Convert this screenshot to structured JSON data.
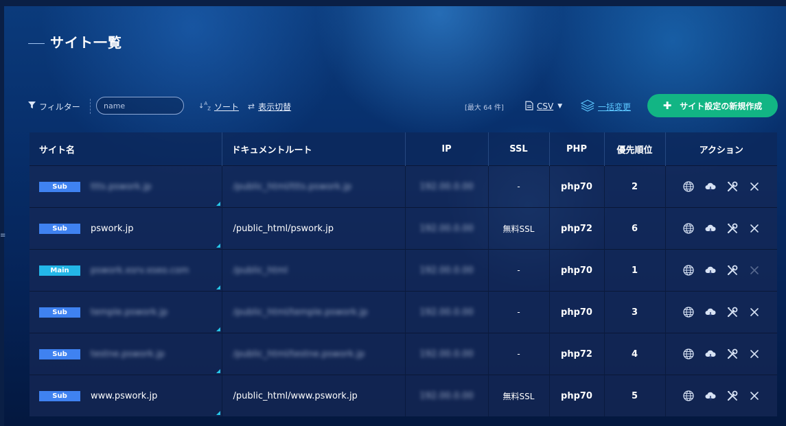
{
  "page": {
    "title": "サイト一覧"
  },
  "toolbar": {
    "filter_label": "フィルター",
    "search_placeholder": "name",
    "sort_label": "ソート",
    "display_toggle_label": "表示切替",
    "max_count": "[最大 64 件]",
    "csv_label": "CSV",
    "bulk_change_label": "一括変更",
    "create_label": "サイト設定の新規作成"
  },
  "table": {
    "headers": [
      "サイト名",
      "ドキュメントルート",
      "IP",
      "SSL",
      "PHP",
      "優先順位",
      "アクション"
    ],
    "rows": [
      {
        "type": "Sub",
        "name": "ttts.pswork.jp",
        "name_hidden": true,
        "root": "/public_html/ttts.pswork.jp",
        "root_hidden": true,
        "ip": "192.00.0.00",
        "ip_hidden": true,
        "ssl": "-",
        "php": "php70",
        "priority": "2",
        "delete_enabled": true
      },
      {
        "type": "Sub",
        "name": "pswork.jp",
        "name_hidden": false,
        "root": "/public_html/pswork.jp",
        "root_hidden": false,
        "ip": "192.00.0.00",
        "ip_hidden": true,
        "ssl": "無料SSL",
        "php": "php72",
        "priority": "6",
        "delete_enabled": true
      },
      {
        "type": "Main",
        "name": "pswork.xsrv.xseo.com",
        "name_hidden": true,
        "root": "/public_html",
        "root_hidden": true,
        "ip": "192.00.0.00",
        "ip_hidden": true,
        "ssl": "-",
        "php": "php70",
        "priority": "1",
        "delete_enabled": false
      },
      {
        "type": "Sub",
        "name": "temple.pswork.jp",
        "name_hidden": true,
        "root": "/public_html/temple.pswork.jp",
        "root_hidden": true,
        "ip": "192.00.0.00",
        "ip_hidden": true,
        "ssl": "-",
        "php": "php70",
        "priority": "3",
        "delete_enabled": true
      },
      {
        "type": "Sub",
        "name": "testne.pswork.jp",
        "name_hidden": true,
        "root": "/public_html/testne.pswork.jp",
        "root_hidden": true,
        "ip": "192.00.0.00",
        "ip_hidden": true,
        "ssl": "-",
        "php": "php72",
        "priority": "4",
        "delete_enabled": true
      },
      {
        "type": "Sub",
        "name": "www.pswork.jp",
        "name_hidden": false,
        "root": "/public_html/www.pswork.jp",
        "root_hidden": false,
        "ip": "192.00.0.00",
        "ip_hidden": true,
        "ssl": "無料SSL",
        "php": "php70",
        "priority": "5",
        "delete_enabled": true
      }
    ]
  },
  "colors": {
    "accent_green": "#12b584",
    "badge_sub": "#3f82f1",
    "badge_main": "#23b7e8",
    "link_blue": "#5cc7ff"
  }
}
